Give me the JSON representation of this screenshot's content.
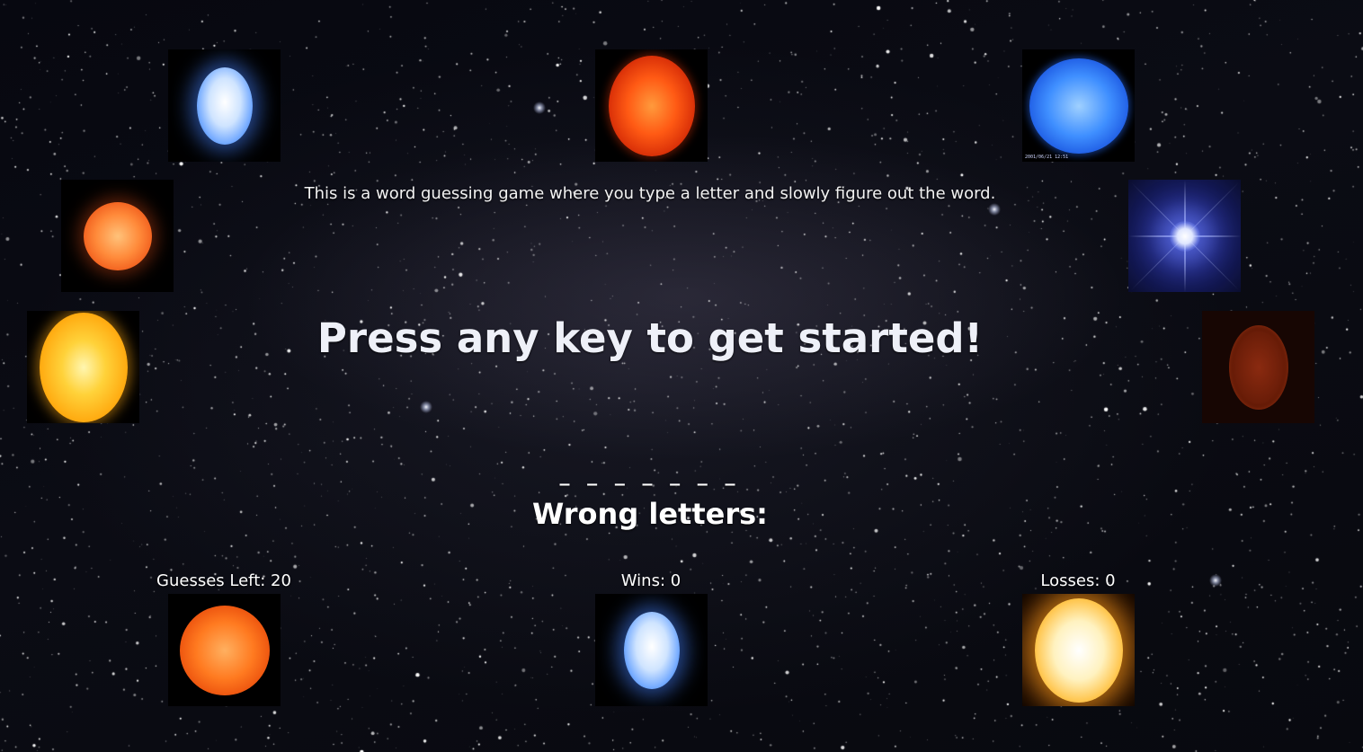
{
  "intro_text": "This is a word guessing game where you type a letter and slowly figure out the word.",
  "prompt_text": "Press any key to get started!",
  "word_blanks": "_ _ _ _ _ _ _",
  "wrong_letters_label": "Wrong letters:",
  "stats": {
    "guesses_left": "Guesses Left: 20",
    "wins": "Wins: 0",
    "losses": "Losses: 0"
  },
  "tile_caption": "2001/06/21 12:51",
  "colors": {
    "background": "#05060c",
    "text": "#ffffff"
  },
  "star_images": [
    "blue-white-star",
    "red-sun",
    "blue-sun",
    "orange-sun",
    "sparkling-blue-star",
    "yellow-sun",
    "dim-red-star",
    "flaring-orange-sun",
    "blue-white-star",
    "bright-yellow-sun"
  ]
}
